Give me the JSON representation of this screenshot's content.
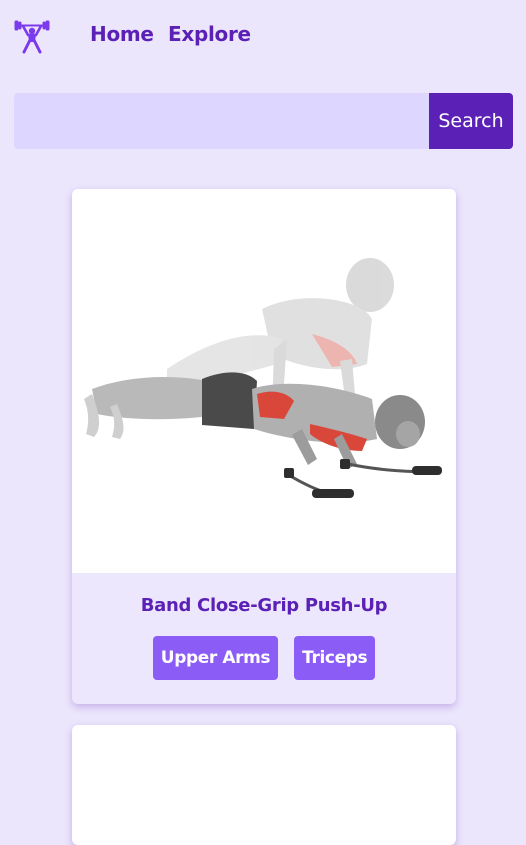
{
  "nav": {
    "logo_icon": "weightlifter-icon",
    "links": [
      {
        "label": "Home"
      },
      {
        "label": "Explore"
      }
    ]
  },
  "search": {
    "value": "",
    "placeholder": "",
    "button_label": "Search"
  },
  "exercises": [
    {
      "title": "Band Close-Grip Push-Up",
      "image": "push-up-illustration",
      "tags": [
        "Upper Arms",
        "Triceps"
      ]
    }
  ],
  "colors": {
    "background": "#ece6fc",
    "primary": "#5b21b6",
    "tag": "#8b5cf6",
    "input": "#ddd6fe",
    "muscle_highlight": "#d9473a"
  }
}
